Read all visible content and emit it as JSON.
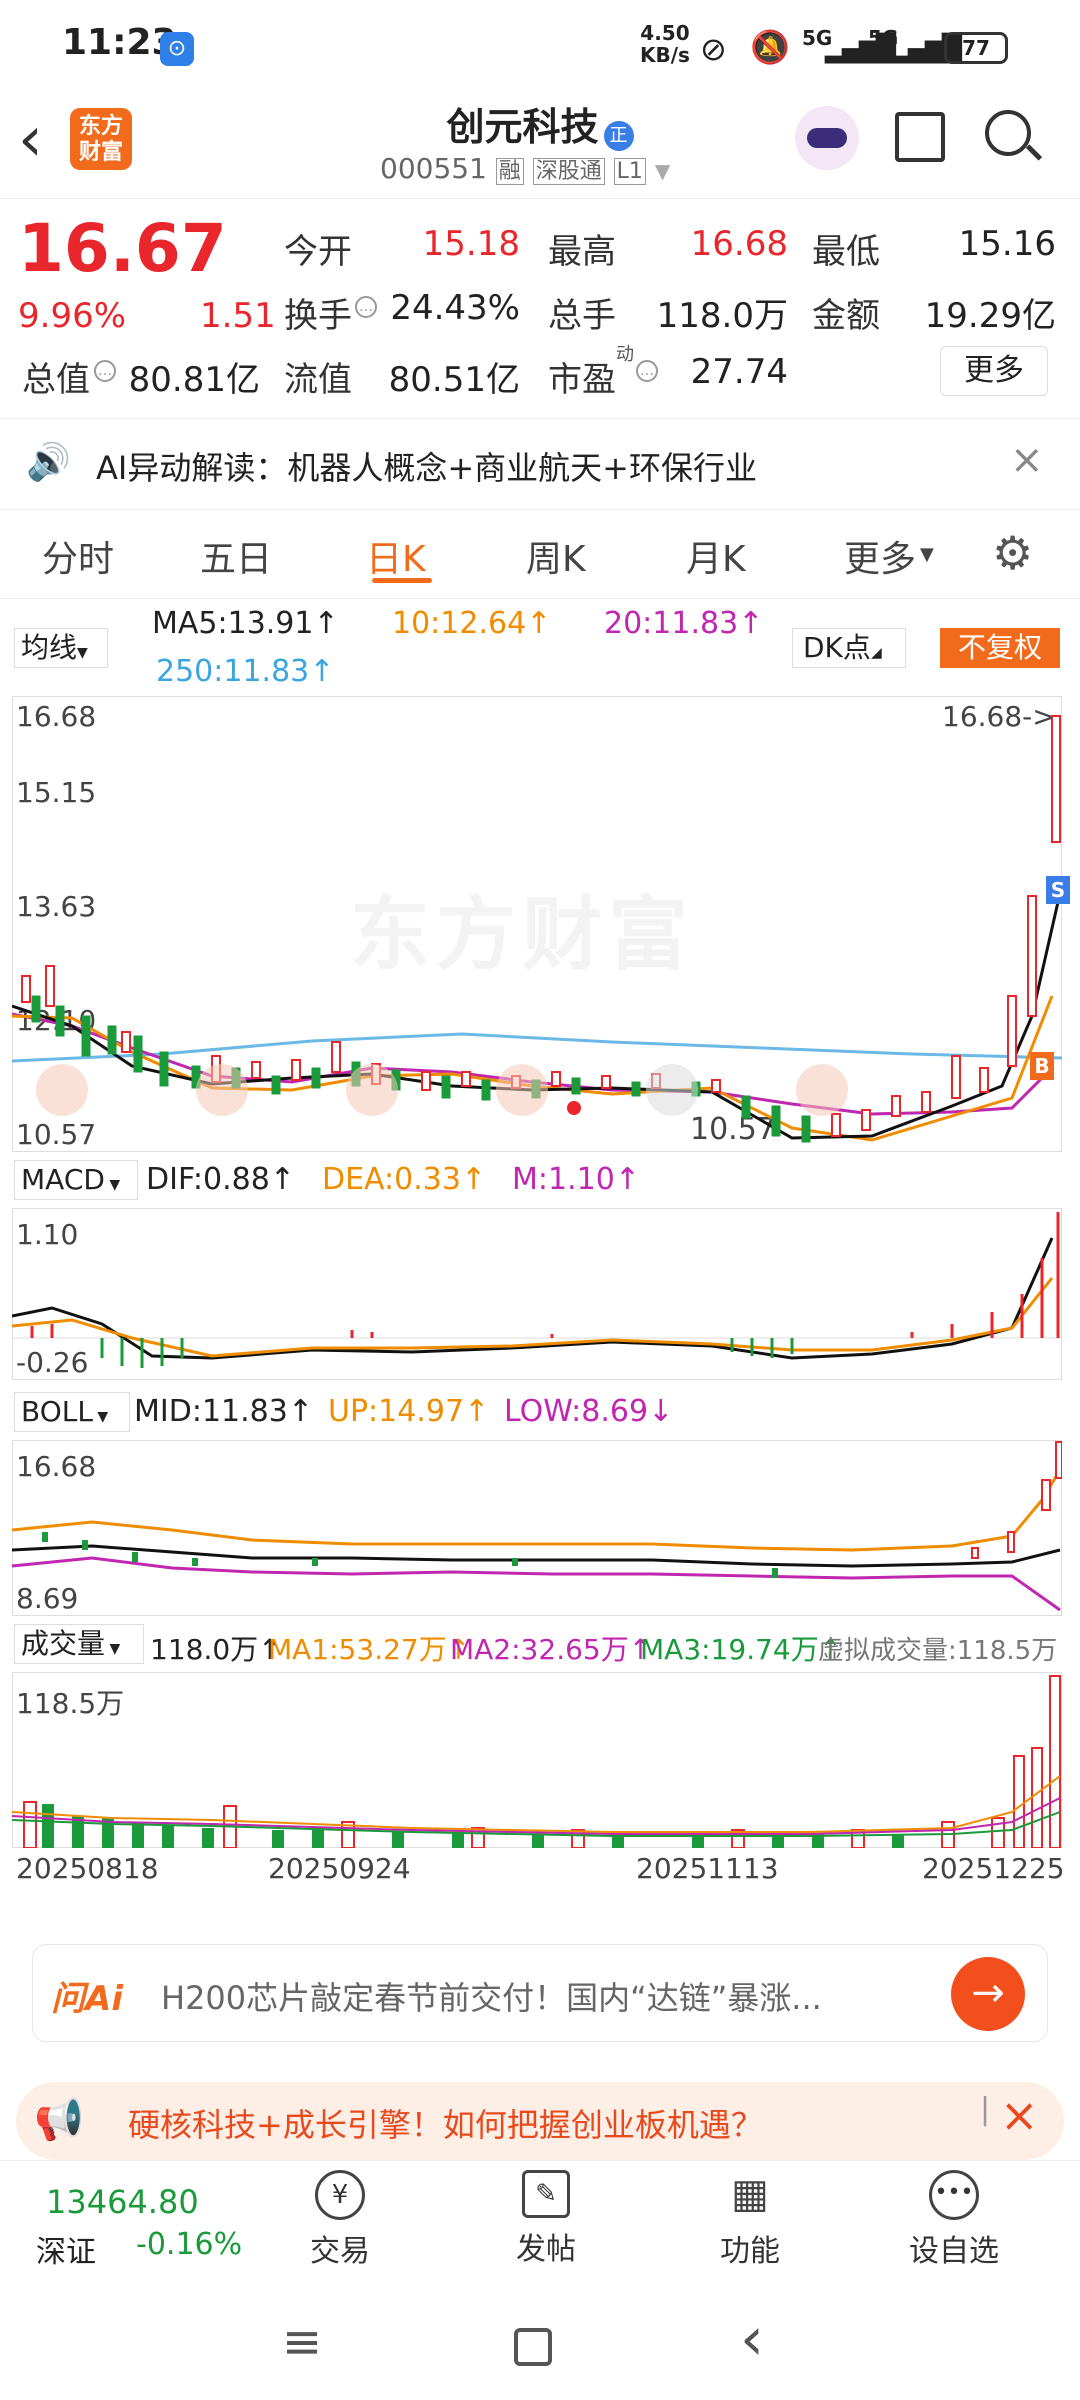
{
  "status_bar": {
    "time": "11:23",
    "net_speed_top": "4.50",
    "net_speed_bottom": "KB/s",
    "signal1": "5G",
    "signal2": "5G",
    "battery": "77"
  },
  "header": {
    "app_logo": "东方财富",
    "title": "创元科技",
    "title_badge": "正",
    "code": "000551",
    "tag1": "融",
    "tag2": "深股通",
    "tag3": "L1"
  },
  "quote": {
    "price": "16.67",
    "change_pct": "9.96%",
    "change": "1.51",
    "open_label": "今开",
    "open": "15.18",
    "high_label": "最高",
    "high": "16.68",
    "low_label": "最低",
    "low": "15.16",
    "turnover_label": "换手",
    "turnover": "24.43%",
    "volume_label": "总手",
    "volume": "118.0万",
    "amount_label": "金额",
    "amount": "19.29亿",
    "mktcap_label": "总值",
    "mktcap": "80.81亿",
    "float_label": "流值",
    "float": "80.51亿",
    "pe_label": "市盈",
    "pe_sup": "动",
    "pe": "27.74",
    "more_button": "更多"
  },
  "banner": {
    "text": "AI异动解读：机器人概念+商业航天+环保行业"
  },
  "tabs": [
    "分时",
    "五日",
    "日K",
    "周K",
    "月K",
    "更多"
  ],
  "ma_row": {
    "selector": "均线",
    "ma5": "MA5:13.91↑",
    "ma10": "10:12.64↑",
    "ma20": "20:11.83↑",
    "ma250": "250:11.83↑",
    "dk": "DK点",
    "fq": "不复权"
  },
  "kline": {
    "top_label": "16.68",
    "l2": "15.15",
    "l3": "13.63",
    "l4": "12.10",
    "bottom_label": "10.57",
    "high_marker": "16.68->",
    "low_marker": "10.57",
    "watermark": "东方财富",
    "s_badge": "S",
    "b_badge": "B"
  },
  "macd": {
    "selector": "MACD",
    "dif": "DIF:0.88↑",
    "dea": "DEA:0.33↑",
    "m": "M:1.10↑",
    "top": "1.10",
    "bottom": "-0.26"
  },
  "boll": {
    "selector": "BOLL",
    "mid": "MID:11.83↑",
    "up": "UP:14.97↑",
    "low": "LOW:8.69↓",
    "top": "16.68",
    "bottom": "8.69"
  },
  "vol": {
    "selector": "成交量",
    "v": "118.0万↑",
    "ma1": "MA1:53.27万↑",
    "ma2": "MA2:32.65万↑",
    "ma3": "MA3:19.74万↑",
    "virtual": "虚拟成交量:118.5万",
    "top": "118.5万"
  },
  "dates": [
    "20250818",
    "20250924",
    "20251113",
    "20251225"
  ],
  "ai_bar": {
    "logo": "问Ai",
    "text": "H200芯片敲定春节前交付！国内“达链”暴涨..."
  },
  "promo": {
    "text": "硬核科技+成长引擎！如何把握创业板机遇？"
  },
  "bottom_nav": {
    "index_value": "13464.80",
    "index_name": "深证",
    "index_change": "-0.16%",
    "items": [
      "交易",
      "发帖",
      "功能",
      "设自选"
    ]
  },
  "colors": {
    "up": "#e8262b",
    "down": "#1a9a3a",
    "accent": "#f26b1d"
  }
}
